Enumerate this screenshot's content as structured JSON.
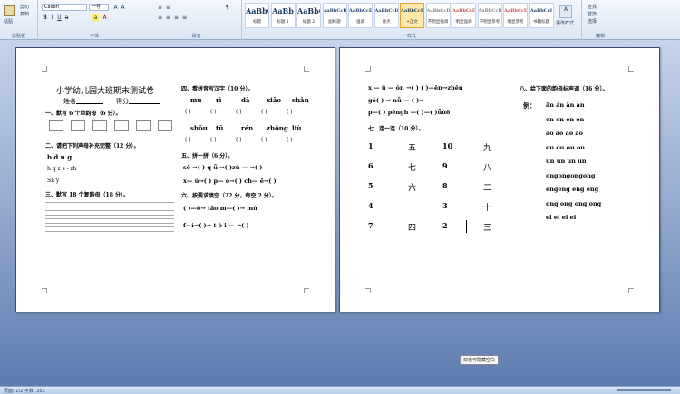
{
  "ribbon": {
    "clipboard": {
      "paste": "粘贴",
      "cut": "剪切",
      "copy": "复制",
      "label": "剪贴板"
    },
    "font": {
      "name": "Calibri",
      "size": "一号",
      "label": "字体",
      "bold": "B",
      "italic": "I",
      "underline": "U"
    },
    "paragraph": {
      "label": "段落"
    },
    "styles": {
      "label": "样式",
      "items": [
        {
          "preview": "AaBbC",
          "name": "标题"
        },
        {
          "preview": "AaBb",
          "name": "标题 1"
        },
        {
          "preview": "AaBbC",
          "name": "标题 2"
        },
        {
          "preview": "AaBbCcD",
          "name": "副标题"
        },
        {
          "preview": "AaBbCcD",
          "name": "强调"
        },
        {
          "preview": "AaBbCcD",
          "name": "要点"
        },
        {
          "preview": "AaBbCcDd",
          "name": "+正文"
        },
        {
          "preview": "AaBbCcD",
          "name": "不明显强调"
        },
        {
          "preview": "AaBbCcD",
          "name": "明显强调"
        },
        {
          "preview": "AaBbCcD",
          "name": "不明显参考"
        },
        {
          "preview": "AaBbCcD",
          "name": "明显参考"
        },
        {
          "preview": "AaBbCcI",
          "name": "书籍标题"
        }
      ],
      "change": "更改样式"
    },
    "editing": {
      "label": "编辑",
      "find": "查找",
      "replace": "替换",
      "select": "选择"
    }
  },
  "page1": {
    "title": "小学幼儿园大班期末测试卷",
    "name_field": "姓名",
    "score_field": "得分",
    "q1": "一、默写 6 个单韵母（6 分）。",
    "q2": "二、请把下列声母补充完整（12 分）。",
    "q2_row1": "b  d  n  g",
    "q2_row2": "h  q  z  s  -  zh",
    "q2_row3": "Sh  y",
    "q3": "三、默写 18 个复韵母（18 分）。",
    "q4": "四、看拼音写汉字（10 分）。",
    "q4_pinyin1": [
      "mù",
      "rì",
      "dà",
      "xiǎo",
      "shān"
    ],
    "q4_pinyin2": [
      "shǒu",
      "tǔ",
      "rén",
      "zhōng",
      "liù"
    ],
    "paren": "(    )",
    "q5": "五、拼一拼（6 分）。",
    "q5_row1": "sō  →(    )   q  ǖ  →(   )zǔ  —  →(   )",
    "q5_row2": "x—  ǖ→(    )   p—  ó→(    )  ch—  ē→(   )",
    "q6": "六、按要求填空（22 分，每空 2 分）。",
    "q6_row1": "(   )—ǒ→ tǎo        m—(   )→ mù",
    "q6_row2": "f—í→(   )→ t ò i  —     →(   )"
  },
  "page2": {
    "r1": "x — ū — ǒn →(    )  (   )—ēn→zhēn",
    "r2": "gǒ(    )  →       nǚ — (    )→",
    "r3": "p—(    )   pēngh   —(   )—(   )ǚùō",
    "q7": "七、连一连（10 分）。",
    "match": [
      {
        "num": "1",
        "hz": "五",
        "num2": "10",
        "hz2": "九"
      },
      {
        "num": "6",
        "hz": "七",
        "num2": "9",
        "hz2": "八"
      },
      {
        "num": "5",
        "hz": "六",
        "num2": "8",
        "hz2": "二"
      },
      {
        "num": "4",
        "hz": "一",
        "num2": "3",
        "hz2": "十"
      },
      {
        "num": "7",
        "hz": "四",
        "num2": "2",
        "hz2": "三"
      }
    ],
    "q8": "八、给下面的韵母标声调（16 分）。",
    "example": "例：",
    "tones": [
      "ān    án    ǎn    àn",
      "en    en    en    en",
      "ao    ao    ao    ao",
      "ou    ou    ou    ou",
      "un    un    un    un",
      "ongongongong",
      "engeng  eng    eng",
      "ong   ong   ong   ong",
      "ei     ei     ei     ei"
    ]
  },
  "tooltip": "双击可隐藏空白",
  "status": {
    "left": "页面: 1/2   字数: 353"
  }
}
